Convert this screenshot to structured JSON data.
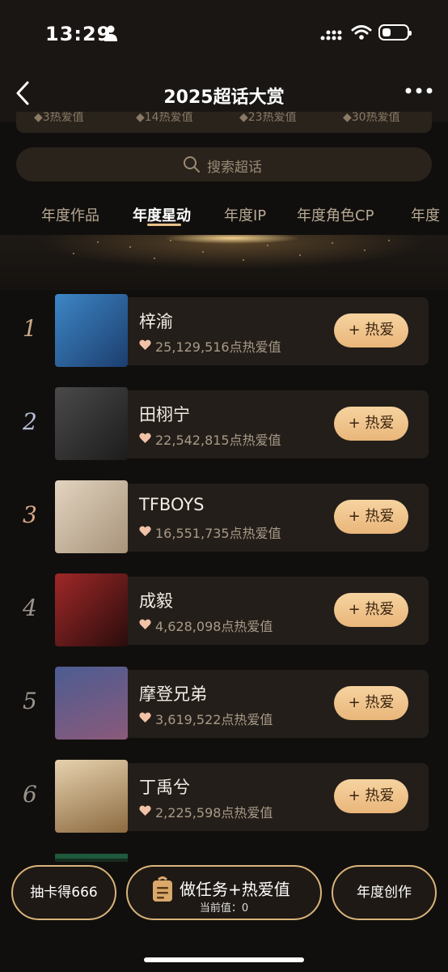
{
  "status": {
    "time": "13:29"
  },
  "nav": {
    "title": "2025超话大赏"
  },
  "peek": [
    "◆3热爱值",
    "◆14热爱值",
    "◆23热爱值",
    "◆30热爱值"
  ],
  "search": {
    "placeholder": "搜索超话"
  },
  "tabs": [
    {
      "label": "年度作品",
      "active": false
    },
    {
      "label": "年度星动",
      "active": true
    },
    {
      "label": "年度IP",
      "active": false
    },
    {
      "label": "年度角色CP",
      "active": false
    },
    {
      "label": "年度",
      "active": false
    }
  ],
  "rankings": [
    {
      "rank": "1",
      "name": "梓渝",
      "heat": "25,129,516点热爱值",
      "button": "+ 热爱",
      "thumb_color": "#2a6fa8"
    },
    {
      "rank": "2",
      "name": "田栩宁",
      "heat": "22,542,815点热爱值",
      "button": "+ 热爱",
      "thumb_color": "#3a3a3a"
    },
    {
      "rank": "3",
      "name": "TFBOYS",
      "heat": "16,551,735点热爱值",
      "button": "+ 热爱",
      "thumb_color": "#c9b29a"
    },
    {
      "rank": "4",
      "name": "成毅",
      "heat": "4,628,098点热爱值",
      "button": "+ 热爱",
      "thumb_color": "#7a1a1a"
    },
    {
      "rank": "5",
      "name": "摩登兄弟",
      "heat": "3,619,522点热爱值",
      "button": "+ 热爱",
      "thumb_color": "#3b4a7a"
    },
    {
      "rank": "6",
      "name": "丁禹兮",
      "heat": "2,225,598点热爱值",
      "button": "+ 热爱",
      "thumb_color": "#c8a878"
    }
  ],
  "bottom": {
    "left": "抽卡得666",
    "task_title": "做任务+热爱值",
    "task_sub": "当前值：0",
    "right": "年度创作"
  }
}
